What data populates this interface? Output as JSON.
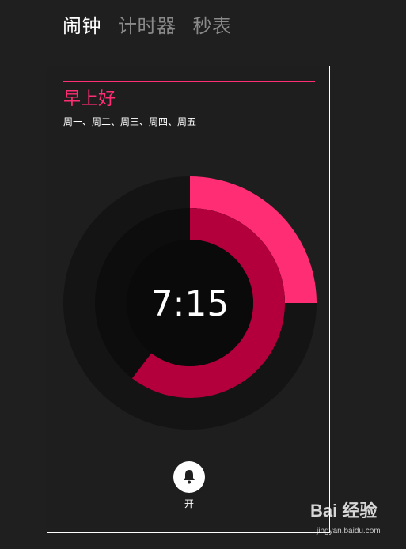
{
  "tabs": [
    {
      "label": "闹钟",
      "active": true
    },
    {
      "label": "计时器",
      "active": false
    },
    {
      "label": "秒表",
      "active": false
    }
  ],
  "alarm": {
    "name": "早上好",
    "days": "周一、周二、周三、周四、周五",
    "time": "7:15",
    "hour": 7,
    "minute": 15,
    "toggle_label": "开",
    "toggle_icon": "bell-icon"
  },
  "colors": {
    "accent": "#ff2d74",
    "hour_arc": "#b3003c",
    "background": "#1f1f1f"
  },
  "watermark": {
    "text": "Bai 经验",
    "url": "jingyan.baidu.com"
  }
}
